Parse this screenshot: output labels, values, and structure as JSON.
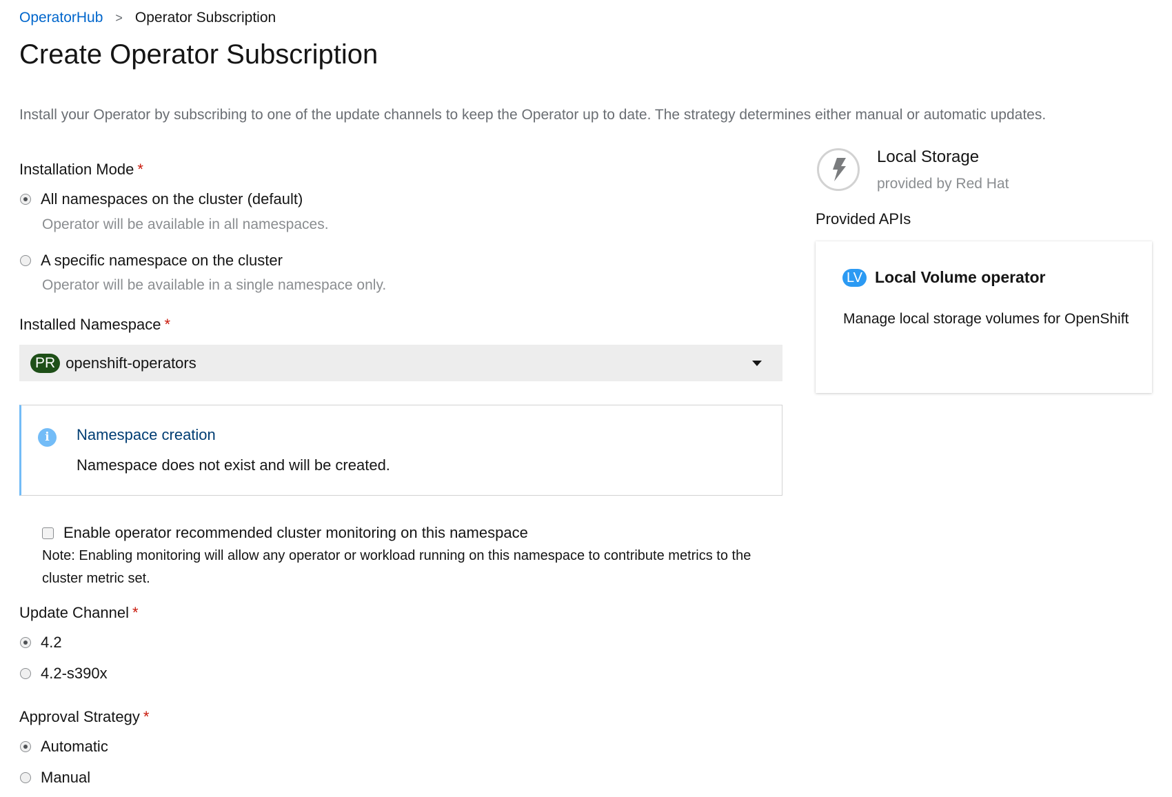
{
  "breadcrumb": {
    "parent": "OperatorHub",
    "separator": ">",
    "current": "Operator Subscription"
  },
  "page": {
    "title": "Create Operator Subscription",
    "description": "Install your Operator by subscribing to one of the update channels to keep the Operator up to date. The strategy determines either manual or automatic updates."
  },
  "installation_mode": {
    "label": "Installation Mode",
    "required_marker": "*",
    "options": [
      {
        "label": "All namespaces on the cluster (default)",
        "help": "Operator will be available in all namespaces.",
        "checked": true
      },
      {
        "label": "A specific namespace on the cluster",
        "help": "Operator will be available in a single namespace only.",
        "checked": false
      }
    ]
  },
  "installed_namespace": {
    "label": "Installed Namespace",
    "required_marker": "*",
    "badge": "PR",
    "value": "openshift-operators"
  },
  "alert": {
    "icon": "info-circle-icon",
    "title": "Namespace creation",
    "body": "Namespace does not exist and will be created."
  },
  "monitoring": {
    "label": "Enable operator recommended cluster monitoring on this namespace",
    "checked": false,
    "note": "Note: Enabling monitoring will allow any operator or workload running on this namespace to contribute metrics to the cluster metric set."
  },
  "update_channel": {
    "label": "Update Channel",
    "required_marker": "*",
    "options": [
      {
        "label": "4.2",
        "checked": true
      },
      {
        "label": "4.2-s390x",
        "checked": false
      }
    ]
  },
  "approval_strategy": {
    "label": "Approval Strategy",
    "required_marker": "*",
    "options": [
      {
        "label": "Automatic",
        "checked": true
      },
      {
        "label": "Manual",
        "checked": false
      }
    ]
  },
  "operator": {
    "icon": "bolt-icon",
    "name": "Local Storage",
    "provider": "provided by Red Hat"
  },
  "provided_apis": {
    "heading": "Provided APIs",
    "items": [
      {
        "badge": "LV",
        "title": "Local Volume operator",
        "description": "Manage local storage volumes for OpenShift"
      }
    ]
  },
  "colors": {
    "link": "#0066cc",
    "required": "#c9190b",
    "namespace_badge": "#1e4f18",
    "api_badge": "#2b9af3",
    "alert_accent": "#73bcf7",
    "alert_title": "#003d73"
  }
}
